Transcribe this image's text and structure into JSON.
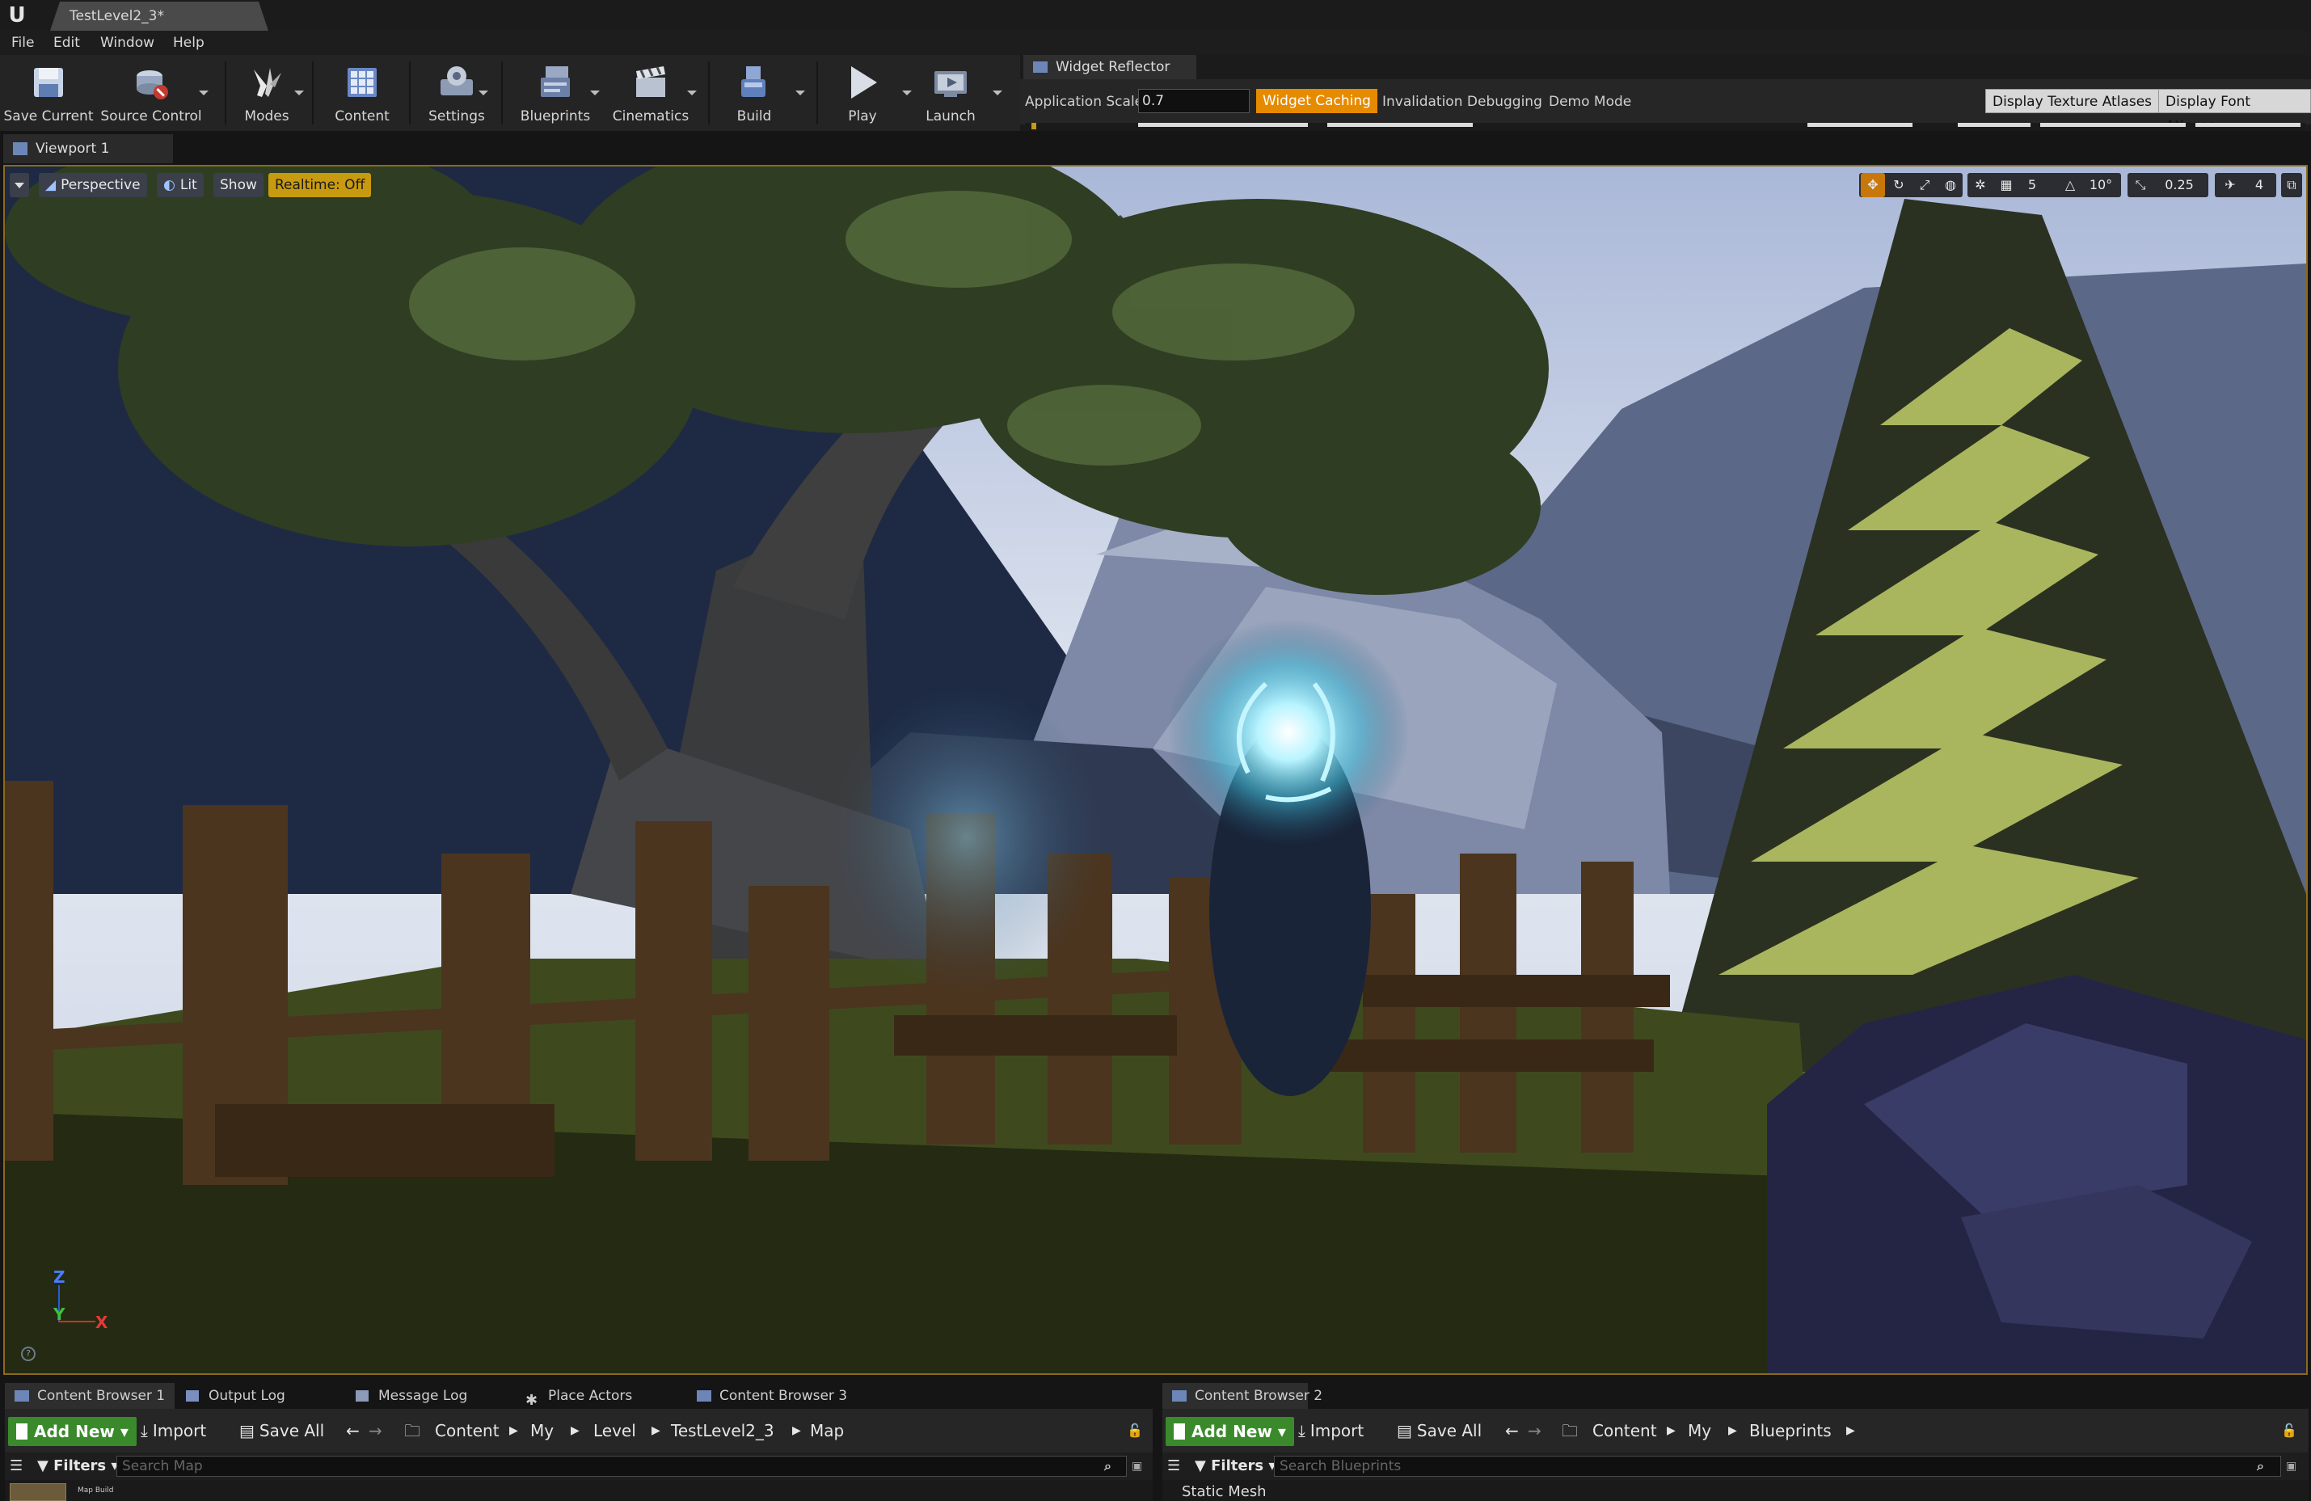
{
  "app": {
    "logo": "U",
    "document_tab": "TestLevel2_3*"
  },
  "menu": [
    "File",
    "Edit",
    "Window",
    "Help"
  ],
  "toolbar": {
    "save_current": "Save Current",
    "source_control": "Source Control",
    "modes": "Modes",
    "content": "Content",
    "settings": "Settings",
    "blueprints": "Blueprints",
    "cinematics": "Cinematics",
    "build": "Build",
    "play": "Play",
    "launch": "Launch"
  },
  "widget_reflector": {
    "tab": "Widget Reflector",
    "app_scale_label": "Application Scale:",
    "app_scale_value": "0.7",
    "widget_caching": "Widget Caching",
    "invalidation_debugging": "Invalidation Debugging",
    "demo_mode": "Demo Mode",
    "display_texture_atlases": "Display Texture Atlases",
    "display_font_atlases": "Display Font Atlases"
  },
  "viewport": {
    "tab": "Viewport 1",
    "perspective": "Perspective",
    "lit": "Lit",
    "show": "Show",
    "realtime": "Realtime: Off",
    "grid_snap": "5",
    "rot_snap": "10°",
    "scale_snap": "0.25",
    "camera_speed": "4",
    "axis_z": "Z",
    "axis_y": "Y",
    "axis_x": "X"
  },
  "bottom_left": {
    "tabs": [
      "Content Browser 1",
      "Output Log",
      "Message Log",
      "Place Actors",
      "Content Browser 3"
    ],
    "add_new": "Add New",
    "import": "Import",
    "save_all": "Save All",
    "path": [
      "Content",
      "My",
      "Level",
      "TestLevel2_3",
      "Map"
    ],
    "filters": "Filters",
    "search_placeholder": "Search Map",
    "asset_label": "Map Build"
  },
  "bottom_right": {
    "tabs": [
      "Content Browser 2"
    ],
    "add_new": "Add New",
    "import": "Import",
    "save_all": "Save All",
    "path": [
      "Content",
      "My",
      "Blueprints"
    ],
    "filters": "Filters",
    "search_placeholder": "Search Blueprints",
    "section": "Static Mesh"
  }
}
